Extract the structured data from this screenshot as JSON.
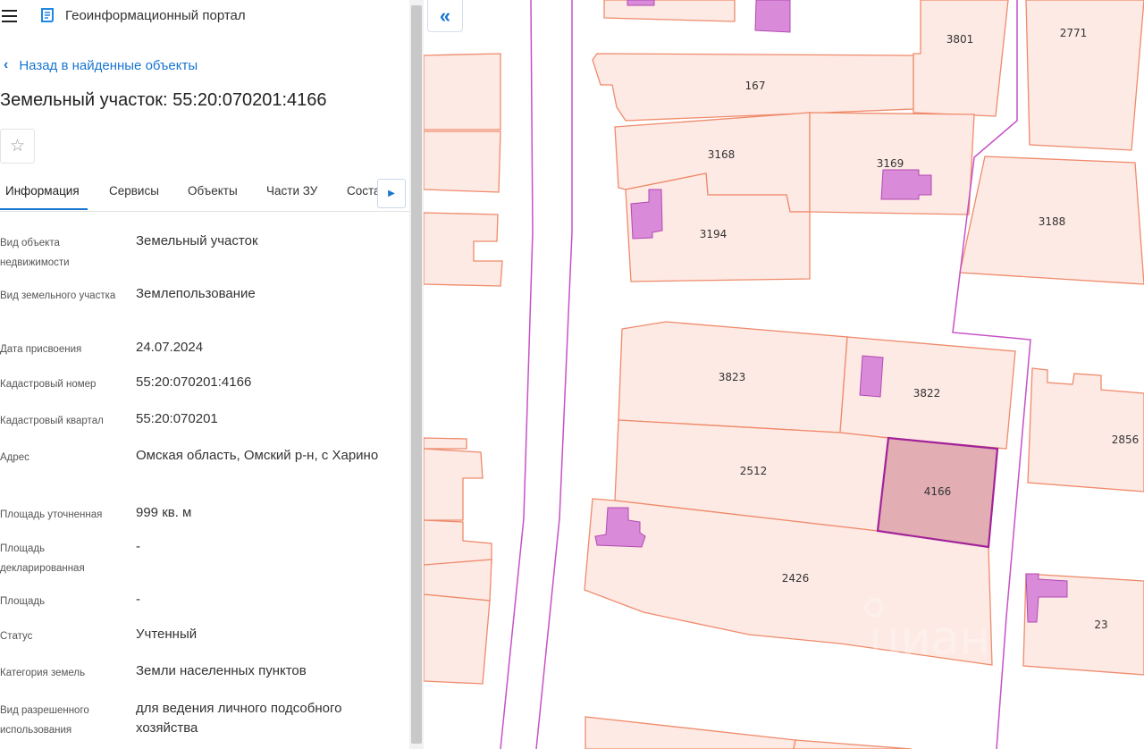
{
  "header": {
    "title": "Геоинформационный портал"
  },
  "nav": {
    "back_label": "Назад в найденные объекты"
  },
  "object": {
    "title": "Земельный участок: 55:20:070201:4166"
  },
  "tabs": [
    {
      "label": "Информация"
    },
    {
      "label": "Сервисы"
    },
    {
      "label": "Объекты"
    },
    {
      "label": "Части ЗУ"
    },
    {
      "label": "Соста"
    }
  ],
  "properties": [
    {
      "label": "Вид объекта недвижимости",
      "value": "Земельный участок"
    },
    {
      "label": "Вид земельного участка",
      "value": "Землепользование"
    },
    {
      "label": "Дата присвоения",
      "value": "24.07.2024"
    },
    {
      "label": "Кадастровый номер",
      "value": "55:20:070201:4166"
    },
    {
      "label": "Кадастровый квартал",
      "value": "55:20:070201"
    },
    {
      "label": "Адрес",
      "value": "Омская область, Омский р-н, с Харино"
    },
    {
      "label": "Площадь уточненная",
      "value": "999 кв. м"
    },
    {
      "label": "Площадь декларированная",
      "value": "-"
    },
    {
      "label": "Площадь",
      "value": "-"
    },
    {
      "label": "Статус",
      "value": "Учтенный"
    },
    {
      "label": "Категория земель",
      "value": "Земли населенных пунктов"
    },
    {
      "label": "Вид разрешенного использования",
      "value": "для ведения личного подсобного хозяйства"
    }
  ],
  "map": {
    "parcel_labels": [
      "3801",
      "2771",
      "167",
      "3168",
      "3169",
      "3188",
      "3194",
      "3823",
      "3822",
      "2856",
      "2512",
      "4166",
      "2426",
      "23"
    ],
    "selected_parcel": "4166",
    "watermark": "циан",
    "colors": {
      "parcel_fill": "#fdeae4",
      "parcel_stroke": "#ef8a6b",
      "building_fill": "#d98ad9",
      "building_stroke": "#b24ab2",
      "boundary": "#c652c6",
      "selected_fill": "#e2aeb4",
      "selected_stroke": "#a2229a",
      "accent": "#1976d2"
    }
  },
  "icons": {
    "menu": "hamburger-icon",
    "logo": "portal-logo-icon",
    "back": "chevron-left-icon",
    "favorite": "star-outline-icon",
    "tab_scroll": "caret-right-icon",
    "collapse": "double-chevron-left-icon"
  }
}
